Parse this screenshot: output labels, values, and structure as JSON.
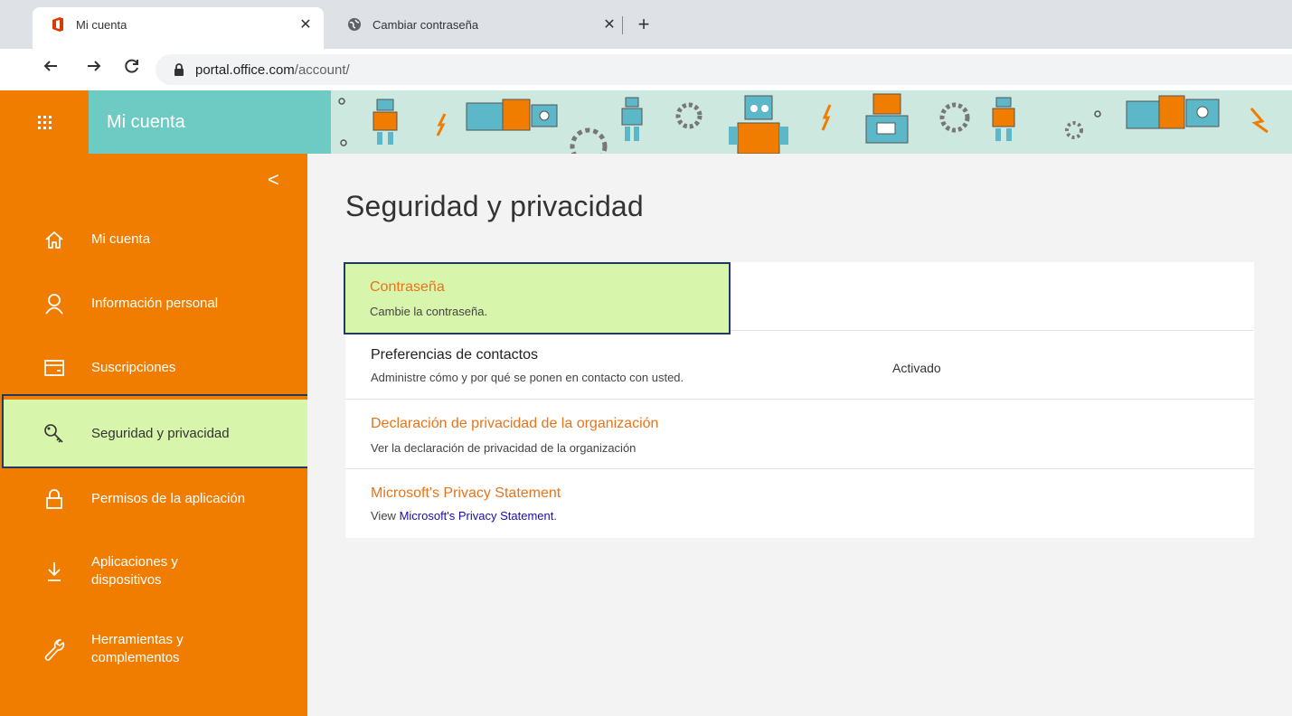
{
  "browser": {
    "tabs": [
      {
        "title": "Mi cuenta",
        "icon": "office-icon",
        "active": true
      },
      {
        "title": "Cambiar contraseña",
        "icon": "globe-icon",
        "active": false
      }
    ],
    "close_glyph": "✕",
    "new_tab_glyph": "+",
    "url_host": "portal.office.com",
    "url_path": "/account/"
  },
  "appbar": {
    "title": "Mi cuenta",
    "brand_color": "#f07d00",
    "title_color": "#6ecbc3"
  },
  "sidebar": {
    "collapse_glyph": "<",
    "items": [
      {
        "label": "Mi cuenta",
        "icon": "home-icon"
      },
      {
        "label": "Información personal",
        "icon": "person-icon"
      },
      {
        "label": "Suscripciones",
        "icon": "card-icon"
      },
      {
        "label": "Seguridad y privacidad",
        "icon": "key-icon",
        "selected": true
      },
      {
        "label": "Permisos de la aplicación",
        "icon": "lock-icon"
      },
      {
        "label_line1": "Aplicaciones y",
        "label_line2": "dispositivos",
        "icon": "download-icon"
      },
      {
        "label_line1": "Herramientas y",
        "label_line2": "complementos",
        "icon": "wrench-icon"
      }
    ]
  },
  "main": {
    "title": "Seguridad y privacidad",
    "rows": [
      {
        "title": "Contraseña",
        "description": "Cambie la contraseña."
      },
      {
        "title": "Preferencias de contactos",
        "description": "Administre cómo y por qué se ponen en contacto con usted.",
        "status": "Activado"
      },
      {
        "title": "Declaración de privacidad de la organización",
        "description": "Ver la declaración de privacidad de la organización"
      },
      {
        "title": "Microsoft's Privacy Statement",
        "description_prefix": "View ",
        "description_link": "Microsoft's Privacy Statement",
        "description_suffix": "."
      }
    ]
  }
}
